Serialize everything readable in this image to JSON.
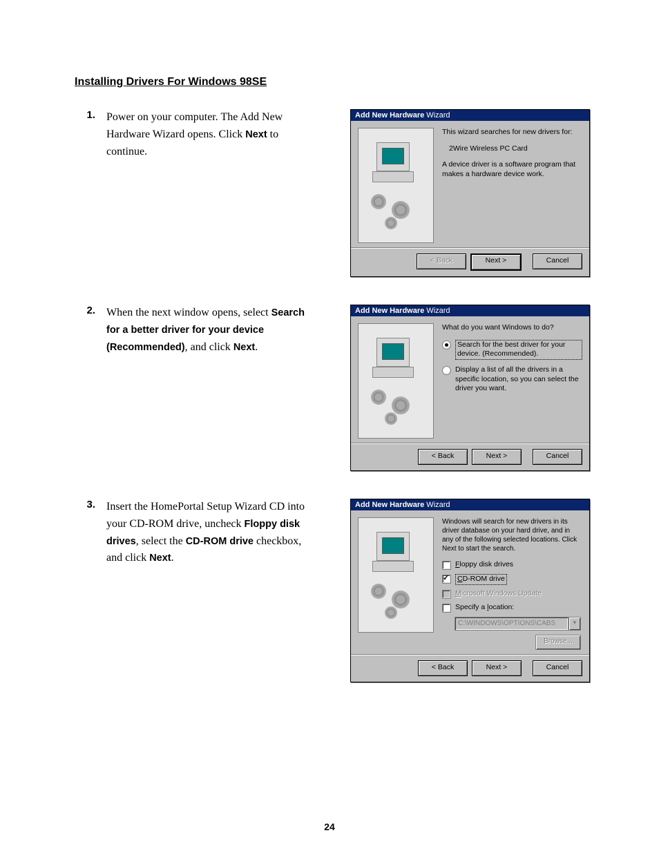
{
  "section_title": "Installing Drivers For Windows 98SE",
  "page_number": "24",
  "steps": [
    {
      "num": "1.",
      "text_plain_1": "Power on your computer. The Add New Hardware Wizard opens. Click ",
      "bold_1": "Next",
      "text_plain_2": " to continue."
    },
    {
      "num": "2.",
      "text_plain_1": "When the next window opens, select ",
      "bold_1": "Search for a better driver for your device (Recommended)",
      "text_plain_2": ", and click ",
      "bold_2": "Next",
      "text_plain_3": "."
    },
    {
      "num": "3.",
      "text_plain_1": "Insert the HomePortal Setup Wizard CD into your CD-ROM drive, uncheck ",
      "bold_1": "Floppy disk drives",
      "text_plain_2": ", select the ",
      "bold_2": "CD-ROM drive",
      "text_plain_3": " checkbox, and click ",
      "bold_3": "Next",
      "text_plain_4": "."
    }
  ],
  "dialogs": {
    "title_bold": "Add New Hardware",
    "title_thin": " Wizard",
    "buttons": {
      "back": "< Back",
      "next": "Next >",
      "cancel": "Cancel",
      "browse": "Browse..."
    },
    "d1": {
      "line1": "This wizard searches for new drivers for:",
      "device": "2Wire Wireless PC Card",
      "line2": "A device driver is a software program that makes a hardware device work."
    },
    "d2": {
      "prompt": "What do you want Windows to do?",
      "opt1": "Search for the best driver for your device. (Recommended).",
      "opt2": "Display a list of all the drivers in a specific location, so you can select the driver you want."
    },
    "d3": {
      "intro": "Windows will search for new drivers in its driver database on your hard drive, and in any of the following selected locations. Click Next to start the search.",
      "chk_floppy": "Floppy disk drives",
      "chk_cdrom": "CD-ROM drive",
      "chk_winupdate": "Microsoft Windows Update",
      "chk_specify": "Specify a location:",
      "path_value": "C:\\WINDOWS\\OPTIONS\\CABS"
    }
  }
}
